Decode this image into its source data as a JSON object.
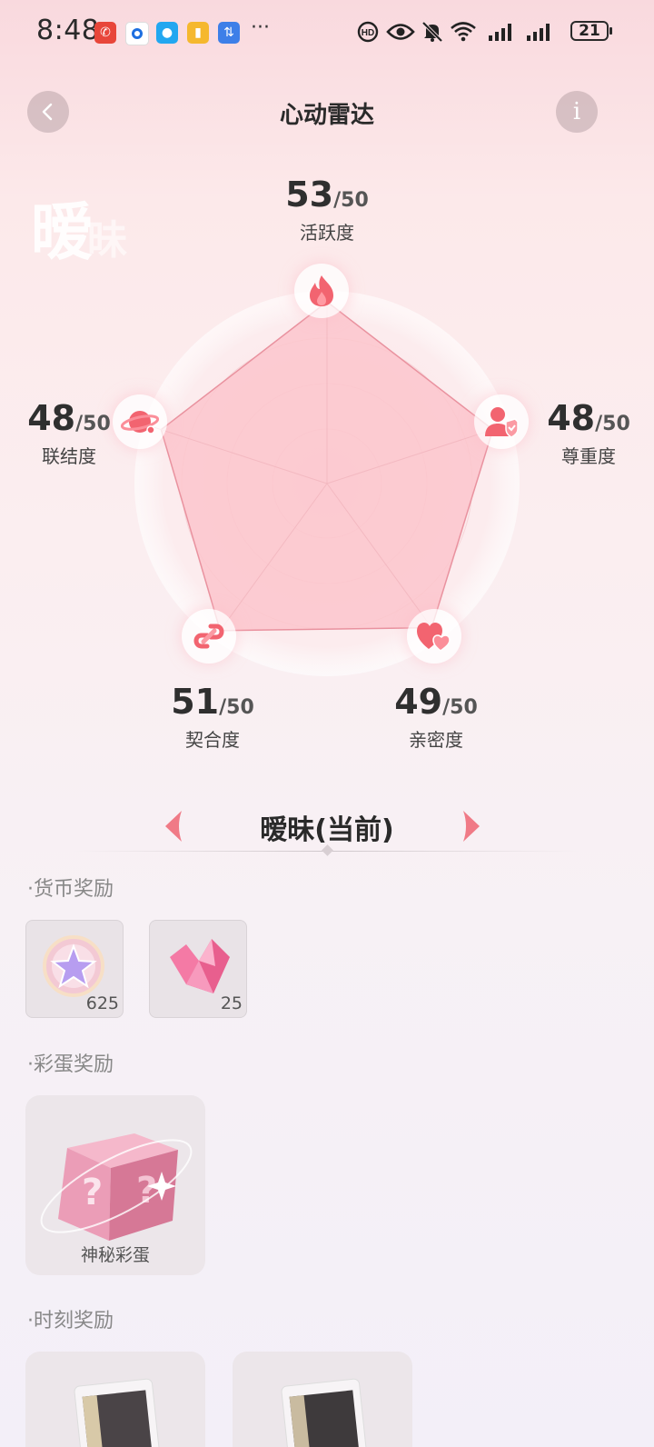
{
  "status_bar": {
    "time": "8:48",
    "dots": "···",
    "battery": "21"
  },
  "header": {
    "title": "心动雷达",
    "back_icon": "chevron-left-icon",
    "info_label": "i"
  },
  "watermark": {
    "main": "暧",
    "sub": "昧"
  },
  "radar": {
    "max": 50,
    "metrics": [
      {
        "key": "activity",
        "value": "53",
        "max_text": "/50",
        "label": "活跃度",
        "icon": "flame-icon"
      },
      {
        "key": "respect",
        "value": "48",
        "max_text": "/50",
        "label": "尊重度",
        "icon": "user-shield-icon"
      },
      {
        "key": "intimacy",
        "value": "49",
        "max_text": "/50",
        "label": "亲密度",
        "icon": "hearts-icon"
      },
      {
        "key": "fit",
        "value": "51",
        "max_text": "/50",
        "label": "契合度",
        "icon": "link-icon"
      },
      {
        "key": "connection",
        "value": "48",
        "max_text": "/50",
        "label": "联结度",
        "icon": "planet-icon"
      }
    ]
  },
  "level": {
    "name": "暧昧(当前)"
  },
  "sections": {
    "currency": {
      "title": "·货币奖励",
      "items": [
        {
          "icon": "star-coin-icon",
          "count": "625"
        },
        {
          "icon": "pink-crystal-icon",
          "count": "25"
        }
      ]
    },
    "easter_egg": {
      "title": "·彩蛋奖励",
      "items": [
        {
          "icon": "mystery-cube-icon",
          "label": "神秘彩蛋"
        }
      ]
    },
    "moments": {
      "title": "·时刻奖励",
      "items": [
        {
          "icon": "photo-card-icon"
        },
        {
          "icon": "photo-card-icon"
        }
      ]
    }
  },
  "colors": {
    "accent": "#f2606e",
    "radar_fill": "#fbc8cf",
    "radar_stroke": "#ea9aa5"
  }
}
